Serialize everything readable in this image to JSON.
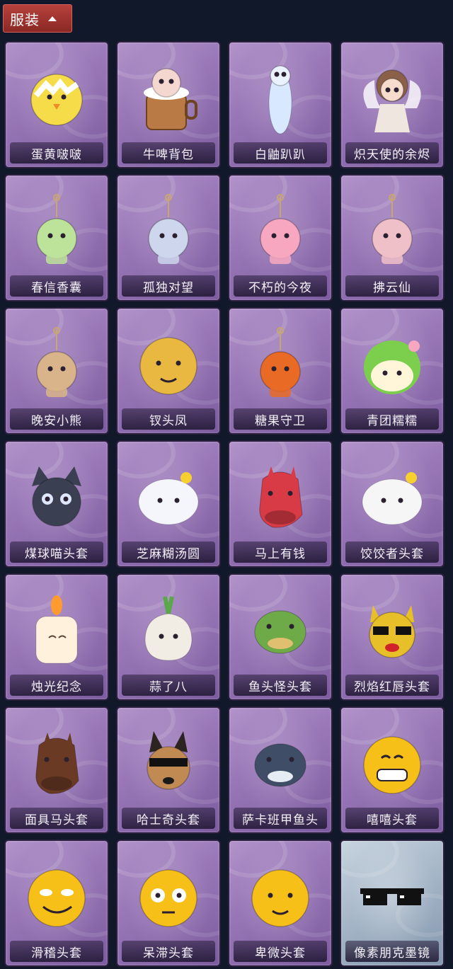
{
  "category": {
    "label": "服装",
    "icon": "chevron-up-icon"
  },
  "items": [
    {
      "name": "蛋黄啵啵",
      "icon": "chick-icon",
      "color": "#f7dc4a"
    },
    {
      "name": "牛啤背包",
      "icon": "beer-barrel-icon",
      "color": "#b97a45"
    },
    {
      "name": "白鼬趴趴",
      "icon": "white-weasel-icon",
      "color": "#d8e8ff"
    },
    {
      "name": "炽天使的余烬",
      "icon": "angel-doll-icon",
      "color": "#f0e6e0"
    },
    {
      "name": "春信香囊",
      "icon": "sachet-icon",
      "color": "#bde29a"
    },
    {
      "name": "孤独对望",
      "icon": "doll-charm-icon",
      "color": "#cdd6ec"
    },
    {
      "name": "不朽的今夜",
      "icon": "cat-cup-charm-icon",
      "color": "#f7a8c0"
    },
    {
      "name": "拂云仙",
      "icon": "fairy-charm-icon",
      "color": "#f0c0c8"
    },
    {
      "name": "晚安小熊",
      "icon": "bear-charm-icon",
      "color": "#d9b48a"
    },
    {
      "name": "钗头凤",
      "icon": "phoenix-doll-icon",
      "color": "#e8b840"
    },
    {
      "name": "糖果守卫",
      "icon": "pumpkin-charm-icon",
      "color": "#e86a24"
    },
    {
      "name": "青团糯糯",
      "icon": "green-mochi-icon",
      "color": "#7ccf4c"
    },
    {
      "name": "煤球喵头套",
      "icon": "black-cat-head-icon",
      "color": "#3a3f52"
    },
    {
      "name": "芝麻糊汤圆",
      "icon": "dumpling-head-icon",
      "color": "#f4f6fb"
    },
    {
      "name": "马上有钱",
      "icon": "red-horse-head-icon",
      "color": "#d83a46"
    },
    {
      "name": "饺饺者头套",
      "icon": "cloud-dumpling-head-icon",
      "color": "#f6f6f6"
    },
    {
      "name": "烛光纪念",
      "icon": "candle-head-icon",
      "color": "#fff1dc"
    },
    {
      "name": "蒜了八",
      "icon": "garlic-head-icon",
      "color": "#f2ede4"
    },
    {
      "name": "鱼头怪头套",
      "icon": "fish-mask-icon",
      "color": "#6eaa48"
    },
    {
      "name": "烈焰红唇头套",
      "icon": "yellow-mask-icon",
      "color": "#e7bf28"
    },
    {
      "name": "面具马头套",
      "icon": "horse-mask-icon",
      "color": "#6a3a24"
    },
    {
      "name": "哈士奇头套",
      "icon": "husky-mask-icon",
      "color": "#c08a52"
    },
    {
      "name": "萨卡班甲鱼头",
      "icon": "fish-head-icon",
      "color": "#3f4d66"
    },
    {
      "name": "嘻嘻头套",
      "icon": "grin-emoji-head-icon",
      "color": "#f7c018"
    },
    {
      "name": "滑稽头套",
      "icon": "smirk-emoji-head-icon",
      "color": "#f7c018"
    },
    {
      "name": "呆滞头套",
      "icon": "stare-emoji-head-icon",
      "color": "#f7c018"
    },
    {
      "name": "卑微头套",
      "icon": "shy-emoji-head-icon",
      "color": "#f7c018"
    },
    {
      "name": "像素朋克墨镜",
      "icon": "pixel-sunglasses-icon",
      "color": "#111111",
      "rare": true
    }
  ]
}
